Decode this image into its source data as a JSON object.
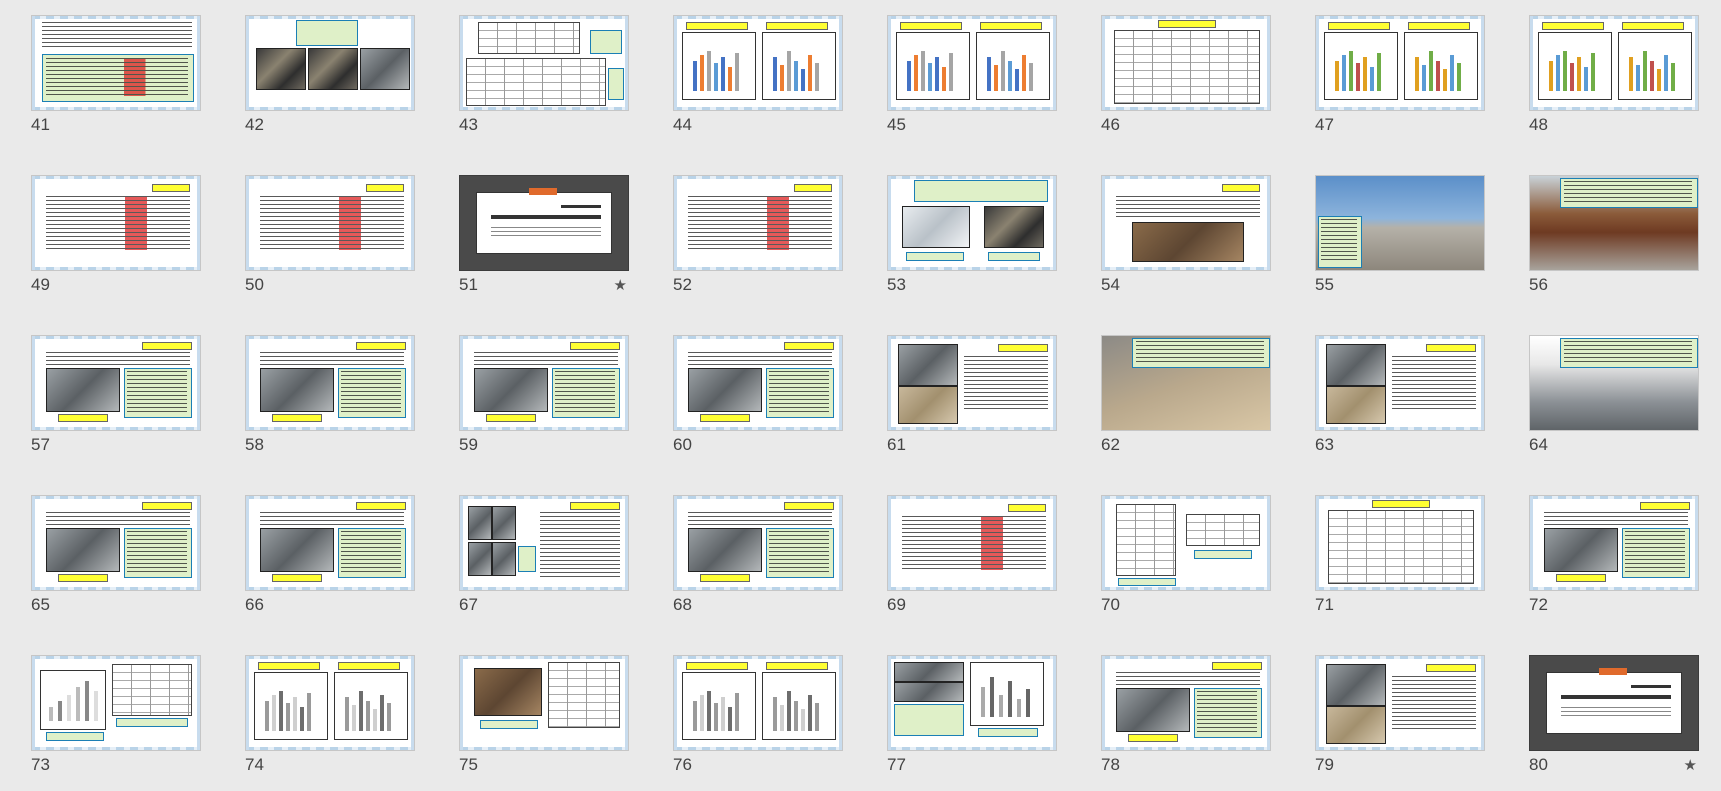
{
  "view": "slide-sorter",
  "slides": [
    {
      "number": "41",
      "kind": "text-green"
    },
    {
      "number": "42",
      "kind": "three-photos"
    },
    {
      "number": "43",
      "kind": "tables"
    },
    {
      "number": "44",
      "kind": "two-bar-charts"
    },
    {
      "number": "45",
      "kind": "two-bar-charts"
    },
    {
      "number": "46",
      "kind": "big-table"
    },
    {
      "number": "47",
      "kind": "two-bar-charts-multi"
    },
    {
      "number": "48",
      "kind": "two-bar-charts-multi"
    },
    {
      "number": "49",
      "kind": "text"
    },
    {
      "number": "50",
      "kind": "text"
    },
    {
      "number": "51",
      "kind": "section-title",
      "has_transition": true
    },
    {
      "number": "52",
      "kind": "text"
    },
    {
      "number": "53",
      "kind": "text-two-photos"
    },
    {
      "number": "54",
      "kind": "text-photo"
    },
    {
      "number": "55",
      "kind": "full-photo-blue"
    },
    {
      "number": "56",
      "kind": "full-photo-rust"
    },
    {
      "number": "57",
      "kind": "text-photo-left"
    },
    {
      "number": "58",
      "kind": "text-photo-left"
    },
    {
      "number": "59",
      "kind": "text-photo-left"
    },
    {
      "number": "60",
      "kind": "text-photo-left"
    },
    {
      "number": "61",
      "kind": "two-photos-text"
    },
    {
      "number": "62",
      "kind": "full-photo-sand"
    },
    {
      "number": "63",
      "kind": "two-photos-text"
    },
    {
      "number": "64",
      "kind": "full-photo-grey"
    },
    {
      "number": "65",
      "kind": "text-photo-left"
    },
    {
      "number": "66",
      "kind": "text-photo-left"
    },
    {
      "number": "67",
      "kind": "photo-grid-text"
    },
    {
      "number": "68",
      "kind": "text-photo-left"
    },
    {
      "number": "69",
      "kind": "text"
    },
    {
      "number": "70",
      "kind": "two-tables"
    },
    {
      "number": "71",
      "kind": "big-table"
    },
    {
      "number": "72",
      "kind": "text-photo-left"
    },
    {
      "number": "73",
      "kind": "chart-table"
    },
    {
      "number": "74",
      "kind": "two-bar-charts-grey"
    },
    {
      "number": "75",
      "kind": "photo-table"
    },
    {
      "number": "76",
      "kind": "two-bar-charts-grey"
    },
    {
      "number": "77",
      "kind": "photos-chart"
    },
    {
      "number": "78",
      "kind": "text-photo-left"
    },
    {
      "number": "79",
      "kind": "two-photos-text"
    },
    {
      "number": "80",
      "kind": "section-title",
      "has_transition": true
    }
  ],
  "transition_icon": "star-icon"
}
